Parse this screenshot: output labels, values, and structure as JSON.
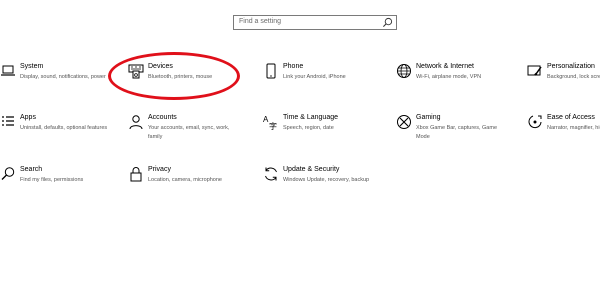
{
  "search": {
    "placeholder": "Find a setting"
  },
  "highlight": {
    "color": "#e0101a",
    "target": "Devices"
  },
  "tiles": [
    {
      "id": "system",
      "icon": "laptop-icon",
      "title": "System",
      "desc": "Display, sound, notifications, power"
    },
    {
      "id": "devices",
      "icon": "keyboard-speaker-icon",
      "title": "Devices",
      "desc": "Bluetooth, printers, mouse"
    },
    {
      "id": "phone",
      "icon": "phone-icon",
      "title": "Phone",
      "desc": "Link your Android, iPhone"
    },
    {
      "id": "network",
      "icon": "globe-icon",
      "title": "Network & Internet",
      "desc": "Wi-Fi, airplane mode, VPN"
    },
    {
      "id": "personalization",
      "icon": "paintbrush-icon",
      "title": "Personalization",
      "desc": "Background, lock screen, colors"
    },
    {
      "id": "apps",
      "icon": "apps-list-icon",
      "title": "Apps",
      "desc": "Uninstall, defaults, optional features"
    },
    {
      "id": "accounts",
      "icon": "person-icon",
      "title": "Accounts",
      "desc": "Your accounts, email, sync, work, family"
    },
    {
      "id": "time",
      "icon": "time-language-icon",
      "title": "Time & Language",
      "desc": "Speech, region, date"
    },
    {
      "id": "gaming",
      "icon": "xbox-icon",
      "title": "Gaming",
      "desc": "Xbox Game Bar, captures, Game Mode"
    },
    {
      "id": "ease",
      "icon": "ease-of-access-icon",
      "title": "Ease of Access",
      "desc": "Narrator, magnifier, high contrast"
    },
    {
      "id": "search",
      "icon": "search-icon",
      "title": "Search",
      "desc": "Find my files, permissions"
    },
    {
      "id": "privacy",
      "icon": "lock-icon",
      "title": "Privacy",
      "desc": "Location, camera, microphone"
    },
    {
      "id": "update",
      "icon": "sync-arrows-icon",
      "title": "Update & Security",
      "desc": "Windows Update, recovery, backup"
    }
  ]
}
